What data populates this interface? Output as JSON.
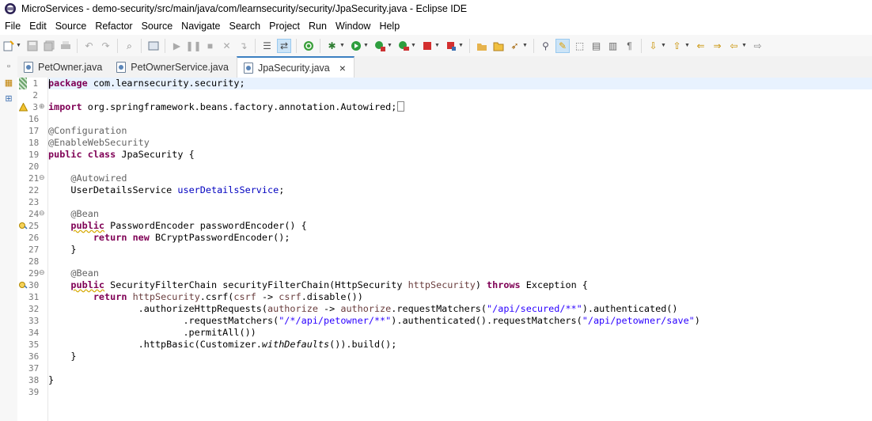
{
  "window": {
    "title": "MicroServices - demo-security/src/main/java/com/learnsecurity/security/JpaSecurity.java - Eclipse IDE"
  },
  "menubar": {
    "items": [
      "File",
      "Edit",
      "Source",
      "Refactor",
      "Source",
      "Navigate",
      "Search",
      "Project",
      "Run",
      "Window",
      "Help"
    ]
  },
  "tabs": [
    {
      "label": "PetOwner.java",
      "active": false
    },
    {
      "label": "PetOwnerService.java",
      "active": false
    },
    {
      "label": "JpaSecurity.java",
      "active": true,
      "close": "×"
    }
  ],
  "editor": {
    "lines": [
      {
        "n": "1",
        "parts": [
          {
            "t": "package",
            "c": "kw"
          },
          {
            "t": " com.learnsecurity.security;"
          }
        ]
      },
      {
        "n": "2",
        "parts": []
      },
      {
        "n": "3",
        "parts": [
          {
            "t": "import",
            "c": "kw"
          },
          {
            "t": " org.springframework.beans.factory.annotation.Autowired;"
          }
        ]
      },
      {
        "n": "16",
        "parts": []
      },
      {
        "n": "17",
        "parts": [
          {
            "t": "@Configuration",
            "c": "ann"
          }
        ]
      },
      {
        "n": "18",
        "parts": [
          {
            "t": "@EnableWebSecurity",
            "c": "ann"
          }
        ]
      },
      {
        "n": "19",
        "parts": [
          {
            "t": "public",
            "c": "kw"
          },
          {
            "t": " "
          },
          {
            "t": "class",
            "c": "kw"
          },
          {
            "t": " JpaSecurity {"
          }
        ]
      },
      {
        "n": "20",
        "parts": []
      },
      {
        "n": "21",
        "parts": [
          {
            "t": "    "
          },
          {
            "t": "@Autowired",
            "c": "ann"
          }
        ]
      },
      {
        "n": "22",
        "parts": [
          {
            "t": "    UserDetailsService "
          },
          {
            "t": "userDetailsService",
            "c": "fld"
          },
          {
            "t": ";"
          }
        ]
      },
      {
        "n": "23",
        "parts": []
      },
      {
        "n": "24",
        "parts": [
          {
            "t": "    "
          },
          {
            "t": "@Bean",
            "c": "ann"
          }
        ]
      },
      {
        "n": "25",
        "parts": [
          {
            "t": "    "
          },
          {
            "t": "public",
            "c": "kw warn"
          },
          {
            "t": " PasswordEncoder passwordEncoder() {"
          }
        ]
      },
      {
        "n": "26",
        "parts": [
          {
            "t": "        "
          },
          {
            "t": "return",
            "c": "kw"
          },
          {
            "t": " "
          },
          {
            "t": "new",
            "c": "kw"
          },
          {
            "t": " BCryptPasswordEncoder();"
          }
        ]
      },
      {
        "n": "27",
        "parts": [
          {
            "t": "    }"
          }
        ]
      },
      {
        "n": "28",
        "parts": []
      },
      {
        "n": "29",
        "parts": [
          {
            "t": "    "
          },
          {
            "t": "@Bean",
            "c": "ann"
          }
        ]
      },
      {
        "n": "30",
        "parts": [
          {
            "t": "    "
          },
          {
            "t": "public",
            "c": "kw warn"
          },
          {
            "t": " SecurityFilterChain securityFilterChain(HttpSecurity "
          },
          {
            "t": "httpSecurity",
            "c": "prm"
          },
          {
            "t": ") "
          },
          {
            "t": "throws",
            "c": "kw"
          },
          {
            "t": " Exception {"
          }
        ]
      },
      {
        "n": "31",
        "parts": [
          {
            "t": "        "
          },
          {
            "t": "return",
            "c": "kw"
          },
          {
            "t": " "
          },
          {
            "t": "httpSecurity",
            "c": "prm"
          },
          {
            "t": ".csrf("
          },
          {
            "t": "csrf",
            "c": "prm"
          },
          {
            "t": " -> "
          },
          {
            "t": "csrf",
            "c": "prm"
          },
          {
            "t": ".disable())"
          }
        ]
      },
      {
        "n": "32",
        "parts": [
          {
            "t": "                .authorizeHttpRequests("
          },
          {
            "t": "authorize",
            "c": "prm"
          },
          {
            "t": " -> "
          },
          {
            "t": "authorize",
            "c": "prm"
          },
          {
            "t": ".requestMatchers("
          },
          {
            "t": "\"/api/secured/**\"",
            "c": "str"
          },
          {
            "t": ").authenticated()"
          }
        ]
      },
      {
        "n": "33",
        "parts": [
          {
            "t": "                        .requestMatchers("
          },
          {
            "t": "\"/*/api/petowner/**\"",
            "c": "str"
          },
          {
            "t": ").authenticated().requestMatchers("
          },
          {
            "t": "\"/api/petowner/save\"",
            "c": "str"
          },
          {
            "t": ")"
          }
        ]
      },
      {
        "n": "34",
        "parts": [
          {
            "t": "                        .permitAll())"
          }
        ]
      },
      {
        "n": "35",
        "parts": [
          {
            "t": "                .httpBasic(Customizer."
          },
          {
            "t": "withDefaults",
            "c": "itl"
          },
          {
            "t": "()).build();"
          }
        ]
      },
      {
        "n": "36",
        "parts": [
          {
            "t": "    }"
          }
        ]
      },
      {
        "n": "37",
        "parts": []
      },
      {
        "n": "38",
        "parts": [
          {
            "t": "}"
          }
        ]
      },
      {
        "n": "39",
        "parts": []
      }
    ]
  }
}
